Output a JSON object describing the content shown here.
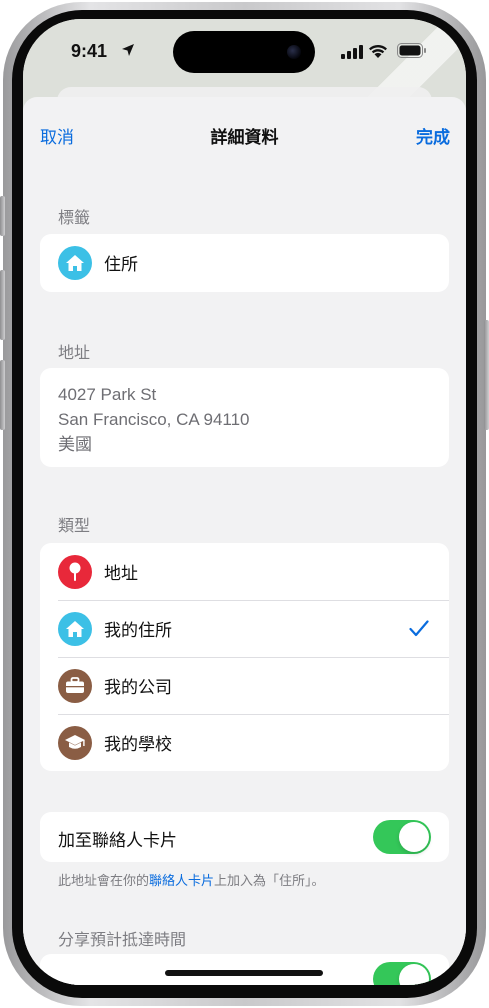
{
  "status_bar": {
    "time": "9:41"
  },
  "nav": {
    "cancel_label": "取消",
    "title": "詳細資料",
    "done_label": "完成"
  },
  "label_section": {
    "header": "標籤",
    "value": "住所"
  },
  "address_section": {
    "header": "地址",
    "lines": [
      "4027 Park St",
      "San Francisco, CA  94110",
      "美國"
    ]
  },
  "type_section": {
    "header": "類型",
    "options": [
      {
        "label": "地址",
        "icon": "pin-icon",
        "color": "#e8283a",
        "selected": false
      },
      {
        "label": "我的住所",
        "icon": "house-icon",
        "color": "#3cc0e6",
        "selected": true
      },
      {
        "label": "我的公司",
        "icon": "briefcase-icon",
        "color": "#8a5d44",
        "selected": false
      },
      {
        "label": "我的學校",
        "icon": "graduation-cap-icon",
        "color": "#8a5d44",
        "selected": false
      }
    ]
  },
  "contact_card": {
    "toggle_label": "加至聯絡人卡片",
    "toggle_on": true,
    "footnote_prefix": "此地址會在你的",
    "footnote_link": "聯絡人卡片",
    "footnote_suffix": "上加入為「住所」。"
  },
  "eta_section": {
    "header": "分享預計抵達時間",
    "toggle_on": true
  },
  "colors": {
    "accent_blue": "#0a6cde",
    "toggle_green": "#34c759",
    "house_cyan": "#3cc0e6",
    "pin_red": "#e8283a",
    "brown": "#8a5d44"
  }
}
